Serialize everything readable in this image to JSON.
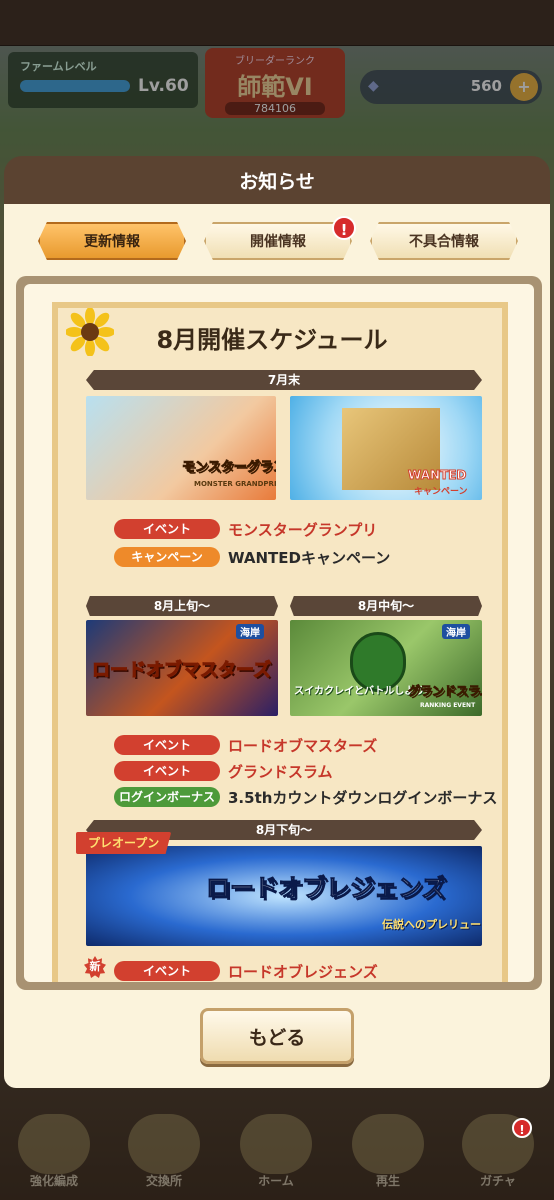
{
  "hud": {
    "farm_label": "ファームレベル",
    "farm_level": "Lv.60",
    "rank_label": "ブリーダーランク",
    "rank_title": "師範VI",
    "rank_id": "784106",
    "coins": "560"
  },
  "modal": {
    "title": "お知らせ",
    "tabs": [
      {
        "label": "更新情報",
        "active": true
      },
      {
        "label": "開催情報",
        "alert": "!"
      },
      {
        "label": "不具合情報"
      }
    ],
    "back_label": "もどる"
  },
  "schedule": {
    "title": "8月開催スケジュール",
    "late_july": "7月末",
    "early_aug": "8月上旬〜",
    "mid_aug": "8月中旬〜",
    "late_aug": "8月下旬〜",
    "banners": {
      "monster_gp": "モンスターグランプリ",
      "monster_gp_sub": "MONSTER GRANDPRIX",
      "wanted": "WANTED",
      "wanted_sub": "キャンペーン",
      "lord_masters": "ロードオブマスターズ",
      "lord_masters_tag": "海岸",
      "grand_slam": "グランドスラム",
      "grand_slam_sub": "RANKING EVENT",
      "grand_slam_tag": "海岸",
      "suika": "スイカクレイとバトルしよう!",
      "preopen": "プレオープン",
      "lord_legends": "ロードオブレジェンズ",
      "legends_sub": "伝説へのプレリュード!"
    },
    "rows": [
      {
        "tag": "イベント",
        "text": "モンスターグランプリ"
      },
      {
        "tag": "キャンペーン",
        "text": "WANTEDキャンペーン"
      },
      {
        "tag": "イベント",
        "text": "ロードオブマスターズ"
      },
      {
        "tag": "イベント",
        "text": "グランドスラム"
      },
      {
        "tag": "ログインボーナス",
        "text": "3.5thカウントダウンログインボーナス"
      },
      {
        "tag": "イベント",
        "text": "ロードオブレジェンズ"
      }
    ],
    "new_badge": "新"
  },
  "nav": [
    {
      "label": "強化編成"
    },
    {
      "label": "交換所"
    },
    {
      "label": "ホーム"
    },
    {
      "label": "再生"
    },
    {
      "label": "ガチャ"
    }
  ],
  "nav_alert": "!"
}
